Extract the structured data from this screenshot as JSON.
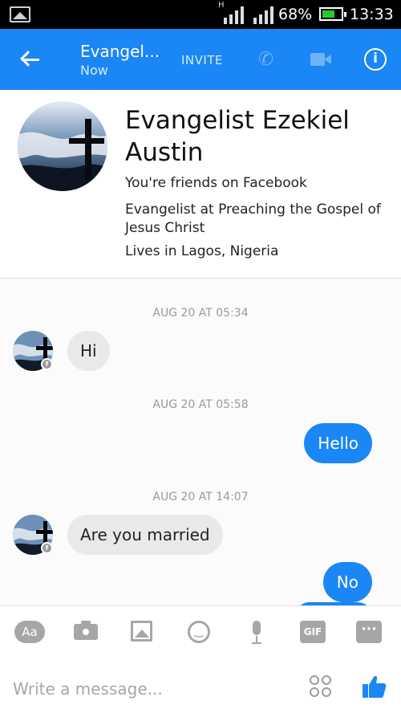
{
  "status_bar": {
    "network_label": "H",
    "battery_percent": "68%",
    "battery_level": 0.68,
    "time": "13:33",
    "icons": [
      "gallery-icon",
      "signal-icon",
      "battery-icon"
    ]
  },
  "header": {
    "contact_name": "Evangel...",
    "contact_status": "Now",
    "invite_label": "INVITE",
    "icons": [
      "back-arrow-icon",
      "phone-icon",
      "video-icon",
      "info-icon"
    ],
    "accent_color": "#1b86f5"
  },
  "profile": {
    "name": "Evangelist Ezekiel Austin",
    "friends": "You're friends on Facebook",
    "work": "Evangelist at Preaching the Gospel of Jesus Christ",
    "location": "Lives in Lagos, Nigeria"
  },
  "conversation": {
    "messages": [
      {
        "timestamp": "AUG 20 AT 05:34",
        "direction": "incoming",
        "text": "Hi"
      },
      {
        "timestamp": "AUG 20 AT 05:58",
        "direction": "outgoing",
        "text": "Hello"
      },
      {
        "timestamp": "AUG 20 AT 14:07",
        "direction": "incoming",
        "text": "Are you married"
      },
      {
        "timestamp": "",
        "direction": "outgoing",
        "text": "No"
      }
    ]
  },
  "composer": {
    "text_label": "Aa",
    "gif_label": "GIF",
    "placeholder": "Write a message...",
    "icons": [
      "camera-icon",
      "image-icon",
      "emoji-icon",
      "microphone-icon",
      "more-icon",
      "sticker-icon",
      "thumbs-up-icon"
    ]
  }
}
